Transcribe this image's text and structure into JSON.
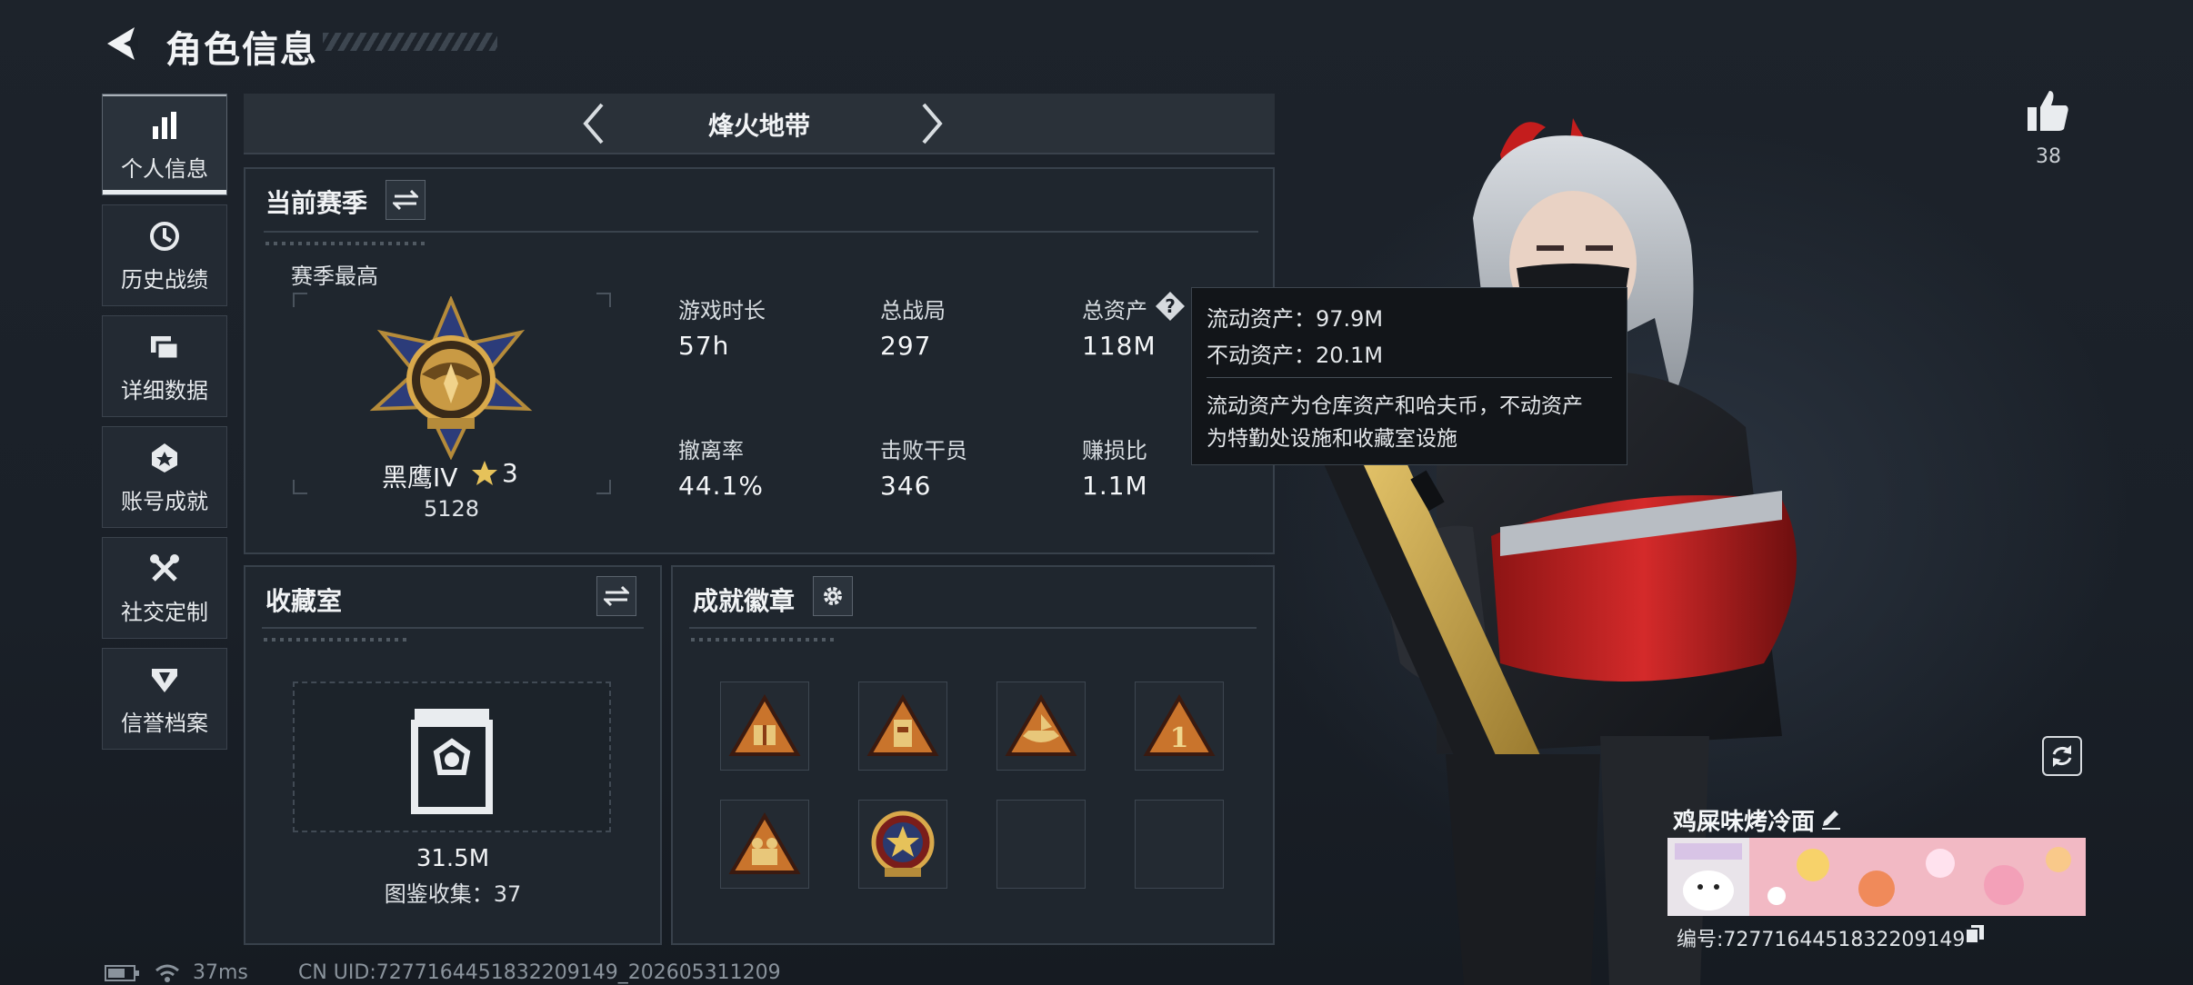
{
  "header": {
    "title": "角色信息"
  },
  "sidebar": {
    "items": [
      {
        "label": "个人信息",
        "icon": "bar-chart-icon",
        "active": true
      },
      {
        "label": "历史战绩",
        "icon": "history-clock-icon",
        "active": false
      },
      {
        "label": "详细数据",
        "icon": "folder-icon",
        "active": false
      },
      {
        "label": "账号成就",
        "icon": "achievement-icon",
        "active": false
      },
      {
        "label": "社交定制",
        "icon": "tools-icon",
        "active": false
      },
      {
        "label": "信誉档案",
        "icon": "reputation-shield-icon",
        "active": false
      }
    ]
  },
  "mode_selector": {
    "label": "烽火地带"
  },
  "season_panel": {
    "title": "当前赛季",
    "season_best_label": "赛季最高",
    "rank_name": "黑鹰IV",
    "rank_stars": "3",
    "rank_score": "5128",
    "stats": [
      {
        "label": "游戏时长",
        "value": "57h"
      },
      {
        "label": "总战局",
        "value": "297"
      },
      {
        "label": "总资产",
        "value": "118M"
      },
      {
        "label": "撤离率",
        "value": "44.1%"
      },
      {
        "label": "击败干员",
        "value": "346"
      },
      {
        "label": "赚损比",
        "value": "1.1M"
      }
    ]
  },
  "tooltip": {
    "liquid": "流动资产：97.9M",
    "fixed": "不动资产：20.1M",
    "desc_line1": "流动资产为仓库资产和哈夫币，不动资产",
    "desc_line2": "为特勤处设施和收藏室设施"
  },
  "collection_panel": {
    "title": "收藏室",
    "value": "31.5M",
    "catalog": "图鉴收集：37"
  },
  "badges_panel": {
    "title": "成就徽章",
    "badges": [
      {
        "icon": "gift-triangle-badge",
        "filled": true
      },
      {
        "icon": "tower-triangle-badge",
        "filled": true
      },
      {
        "icon": "boat-triangle-badge",
        "filled": true
      },
      {
        "icon": "number-one-triangle-badge",
        "filled": true
      },
      {
        "icon": "soldiers-triangle-badge",
        "filled": true
      },
      {
        "icon": "star-emblem-badge",
        "filled": true
      },
      {
        "icon": "empty-slot",
        "filled": false
      },
      {
        "icon": "empty-slot",
        "filled": false
      }
    ]
  },
  "profile": {
    "likes": "38",
    "player_name": "鸡屎味烤冷面",
    "player_id": "编号:7277164451832209149"
  },
  "status": {
    "ping": "37ms",
    "uid": "CN UID:7277164451832209149_202605311209"
  }
}
